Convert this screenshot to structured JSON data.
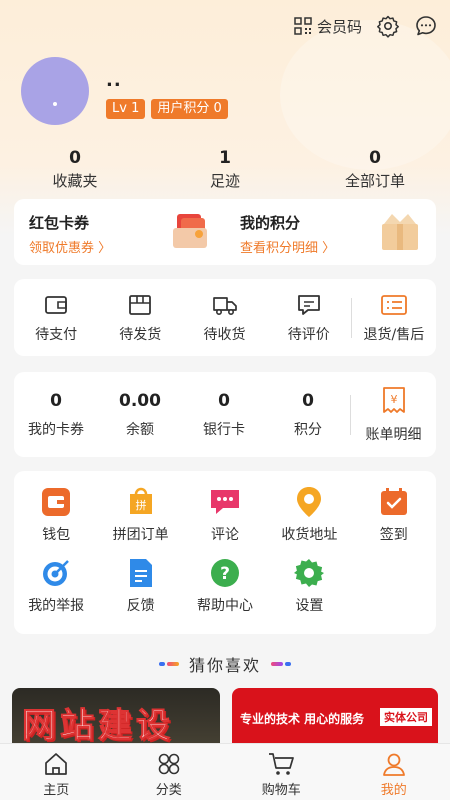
{
  "header": {
    "member_code_label": "会员码"
  },
  "profile": {
    "username": "..",
    "level": "Lv 1",
    "points_badge": "用户积分 0"
  },
  "stats": [
    {
      "value": "0",
      "label": "收藏夹"
    },
    {
      "value": "1",
      "label": "足迹"
    },
    {
      "value": "0",
      "label": "全部订单"
    }
  ],
  "promo": {
    "left": {
      "title": "红包卡券",
      "subtitle": "领取优惠券 〉"
    },
    "right": {
      "title": "我的积分",
      "subtitle": "查看积分明细 〉"
    }
  },
  "orders": [
    {
      "label": "待支付",
      "icon": "wallet-outline-icon"
    },
    {
      "label": "待发货",
      "icon": "box-icon"
    },
    {
      "label": "待收货",
      "icon": "truck-icon"
    },
    {
      "label": "待评价",
      "icon": "comment-icon"
    },
    {
      "label": "退货/售后",
      "icon": "list-icon"
    }
  ],
  "wallet": [
    {
      "value": "0",
      "label": "我的卡券"
    },
    {
      "value": "0.00",
      "label": "余额"
    },
    {
      "value": "0",
      "label": "银行卡"
    },
    {
      "value": "0",
      "label": "积分"
    }
  ],
  "wallet_bill": {
    "label": "账单明细",
    "icon_glyph": "¥"
  },
  "services": [
    {
      "label": "钱包",
      "icon": "wallet-icon"
    },
    {
      "label": "拼团订单",
      "icon": "group-buy-icon",
      "glyph": "拼"
    },
    {
      "label": "评论",
      "icon": "review-icon"
    },
    {
      "label": "收货地址",
      "icon": "location-icon"
    },
    {
      "label": "签到",
      "icon": "calendar-check-icon"
    },
    {
      "label": "我的举报",
      "icon": "target-icon"
    },
    {
      "label": "反馈",
      "icon": "feedback-icon"
    },
    {
      "label": "帮助中心",
      "icon": "help-icon",
      "glyph": "?"
    },
    {
      "label": "设置",
      "icon": "gear-icon"
    }
  ],
  "guess_title": "猜你喜欢",
  "products": {
    "left_text": "网站建设",
    "right_text": "专业的技术 用心的服务",
    "right_tag": "实体公司"
  },
  "tabbar": [
    {
      "label": "主页",
      "icon": "home-icon",
      "active": false
    },
    {
      "label": "分类",
      "icon": "category-icon",
      "active": false
    },
    {
      "label": "购物车",
      "icon": "cart-icon",
      "active": false
    },
    {
      "label": "我的",
      "icon": "profile-icon",
      "active": true
    }
  ],
  "colors": {
    "accent": "#ef7a2a",
    "avatar": "#a9a3e6",
    "header_bg": "#fdeed9"
  }
}
